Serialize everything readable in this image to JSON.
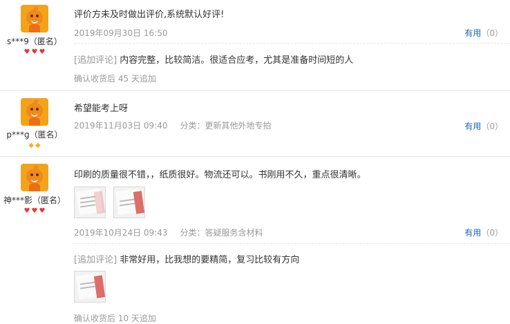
{
  "reviews": [
    {
      "user": "s***9（匿名）",
      "level_icon": "heart-icon",
      "level_count": 3,
      "text": "评价方未及时做出评价,系统默认好评!",
      "date": "2019年09月30日 16:50",
      "category": "",
      "useful_label": "有用",
      "useful_count": "（0）",
      "append": {
        "tag": "[追加评论]",
        "text": " 内容完整，比较简洁。很适合应考，尤其是准备时间短的人",
        "days": "确认收货后 45 天追加"
      }
    },
    {
      "user": "p***g（匿名）",
      "level_icon": "diamond-icon",
      "level_count": 2,
      "text": "希望能考上呀",
      "date": "2019年11月03日 09:40",
      "category": "分类：更新其他外地专拍",
      "useful_label": "有用",
      "useful_count": "（0）"
    },
    {
      "user": "神***影（匿名）",
      "level_icon": "heart-icon",
      "level_count": 3,
      "text": "印刷的质量很不错，，纸质很好。物流还可以。书刚用不久，重点很清晰。",
      "date": "2019年10月24日 09:43",
      "category": "分类：答疑服务含材料",
      "useful_label": "有用",
      "useful_count": "（0）",
      "append": {
        "tag": "[追加评论]",
        "text": " 非常好用，比我想的要精简，复习比较有方向",
        "days": "确认收货后 10 天追加"
      }
    }
  ],
  "colors": {
    "link": "#1a66b3",
    "meta": "#999999",
    "heart": "#e4393c",
    "diamond": "#f6b21b"
  }
}
